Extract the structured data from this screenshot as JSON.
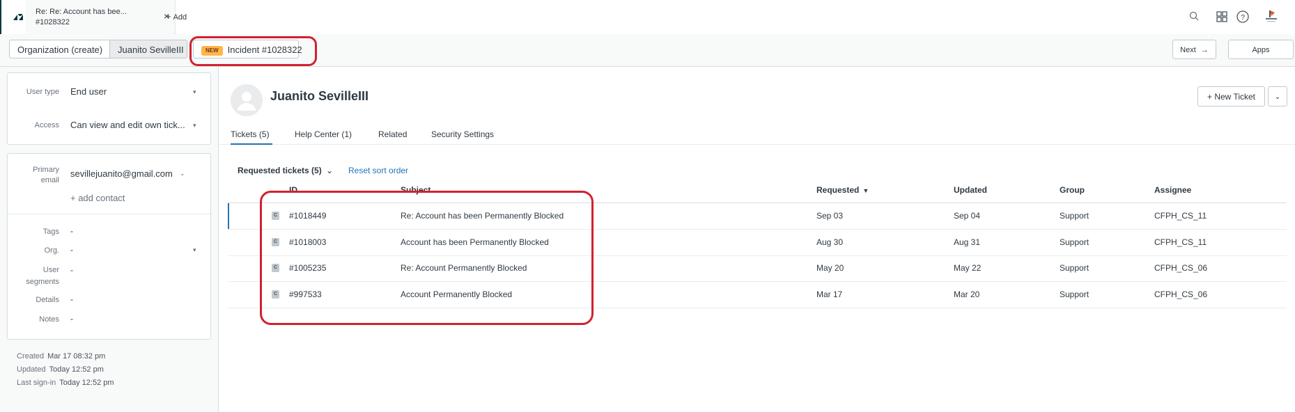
{
  "topbar": {
    "tab_title_line1": "Re: Re: Account has bee...",
    "tab_title_line2": "#1028322",
    "tab_close": "×",
    "add_label": "Add"
  },
  "breadcrumb": {
    "organization": "Organization (create)",
    "user": "Juanito SevilleIII",
    "new_badge": "NEW",
    "incident": "Incident #1028322",
    "next_label": "Next",
    "apps_label": "Apps"
  },
  "user_fields": {
    "user_type_label": "User type",
    "user_type_value": "End user",
    "access_label": "Access",
    "access_value": "Can view and edit own tick...",
    "primary_email_label_1": "Primary",
    "primary_email_label_2": "email",
    "primary_email_value": "sevillejuanito@gmail.com",
    "add_contact": "+ add contact",
    "tags_label": "Tags",
    "tags_value": "-",
    "org_label": "Org.",
    "org_value": "-",
    "segments_label_1": "User",
    "segments_label_2": "segments",
    "segments_value": "-",
    "details_label": "Details",
    "details_value": "-",
    "notes_label": "Notes",
    "notes_value": "-"
  },
  "meta": {
    "created_label": "Created",
    "created_value": "Mar 17 08:32 pm",
    "updated_label": "Updated",
    "updated_value": "Today 12:52 pm",
    "signin_label": "Last sign-in",
    "signin_value": "Today 12:52 pm"
  },
  "profile": {
    "name": "Juanito SevilleIII",
    "new_ticket": "+ New Ticket",
    "tabs": [
      "Tickets (5)",
      "Help Center (1)",
      "Related",
      "Security Settings"
    ]
  },
  "tickets": {
    "title": "Requested tickets (5)",
    "reset_sort": "Reset sort order",
    "headers": {
      "id": "ID",
      "subject": "Subject",
      "requested": "Requested",
      "updated": "Updated",
      "group": "Group",
      "assignee": "Assignee"
    },
    "rows": [
      {
        "badge": "C",
        "id": "#1018449",
        "subject": "Re: Account has been Permanently Blocked",
        "requested": "Sep 03",
        "updated": "Sep 04",
        "group": "Support",
        "assignee": "CFPH_CS_11"
      },
      {
        "badge": "C",
        "id": "#1018003",
        "subject": "Account has been Permanently Blocked",
        "requested": "Aug 30",
        "updated": "Aug 31",
        "group": "Support",
        "assignee": "CFPH_CS_11"
      },
      {
        "badge": "C",
        "id": "#1005235",
        "subject": "Re: Account Permanently Blocked",
        "requested": "May 20",
        "updated": "May 22",
        "group": "Support",
        "assignee": "CFPH_CS_06"
      },
      {
        "badge": "C",
        "id": "#997533",
        "subject": "Account Permanently Blocked",
        "requested": "Mar 17",
        "updated": "Mar 20",
        "group": "Support",
        "assignee": "CFPH_CS_06"
      }
    ]
  },
  "colors": {
    "accent": "#1f73b7",
    "annotation": "#d1212f",
    "new_badge": "#ffb648"
  },
  "icons": [
    "logo-icon",
    "close-icon",
    "plus-icon",
    "search-icon",
    "apps-grid-icon",
    "help-icon",
    "account-avatar-icon",
    "arrow-right-icon",
    "chevron-down-icon",
    "sort-desc-icon",
    "ticket-type-badge"
  ]
}
